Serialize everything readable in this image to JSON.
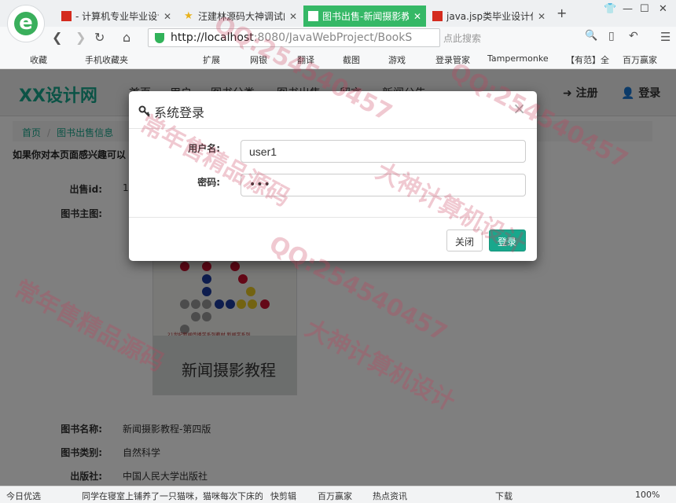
{
  "browser": {
    "tabs": [
      {
        "title": "- 计算机专业毕业设计",
        "active": false
      },
      {
        "title": "汪建林源码大神调试的",
        "active": false
      },
      {
        "title": "图书出售-新闻摄影教程",
        "active": true
      },
      {
        "title": "java.jsp类毕业设计代",
        "active": false
      }
    ],
    "new_tab": "+",
    "url_host": "http://localhost",
    "url_rest": ":8080/JavaWebProject/BookS",
    "search_placeholder": "点此搜索",
    "bookmarks": [
      "收藏",
      "手机收藏夹",
      "扩展",
      "网银",
      "翻译",
      "截图",
      "游戏",
      "登录管家",
      "Tampermonke",
      "【有范】全",
      "百万赢家"
    ]
  },
  "site": {
    "brand": "XX设计网",
    "nav": [
      "首页",
      "用户",
      "图书分类",
      "图书出售",
      "留言",
      "新闻公告"
    ],
    "register": "注册",
    "login": "登录",
    "breadcrumb": [
      "首页",
      "图书出售信息"
    ],
    "note": "如果你对本页面感兴趣可以",
    "fields": {
      "id_label": "出售id:",
      "id_value": "1",
      "image_label": "图书主图:",
      "name_label": "图书名称:",
      "name_value": "新闻摄影教程-第四版",
      "category_label": "图书类别:",
      "category_value": "自然科学",
      "publisher_label": "出版社:",
      "publisher_value": "中国人民大学出版社"
    },
    "cover": {
      "title": "新闻摄影教程",
      "series": "21世纪新闻传播学系列教材 新闻学系列"
    }
  },
  "modal": {
    "title": "系统登录",
    "close_symbol": "×",
    "username_label": "用户名:",
    "username_value": "user1",
    "password_label": "密码:",
    "password_value": "•••",
    "close_button": "关闭",
    "login_button": "登录"
  },
  "statusbar": {
    "left": "今日优选",
    "news": "同学在寝室上铺养了一只猫咪，猫咪每次下床的时",
    "items": [
      "快剪辑",
      "百万赢家",
      "热点资讯",
      "下载"
    ],
    "zoom": "100%"
  },
  "watermarks": [
    "常年售精品源码",
    "大神计算机设计",
    "QQ:254540457"
  ]
}
